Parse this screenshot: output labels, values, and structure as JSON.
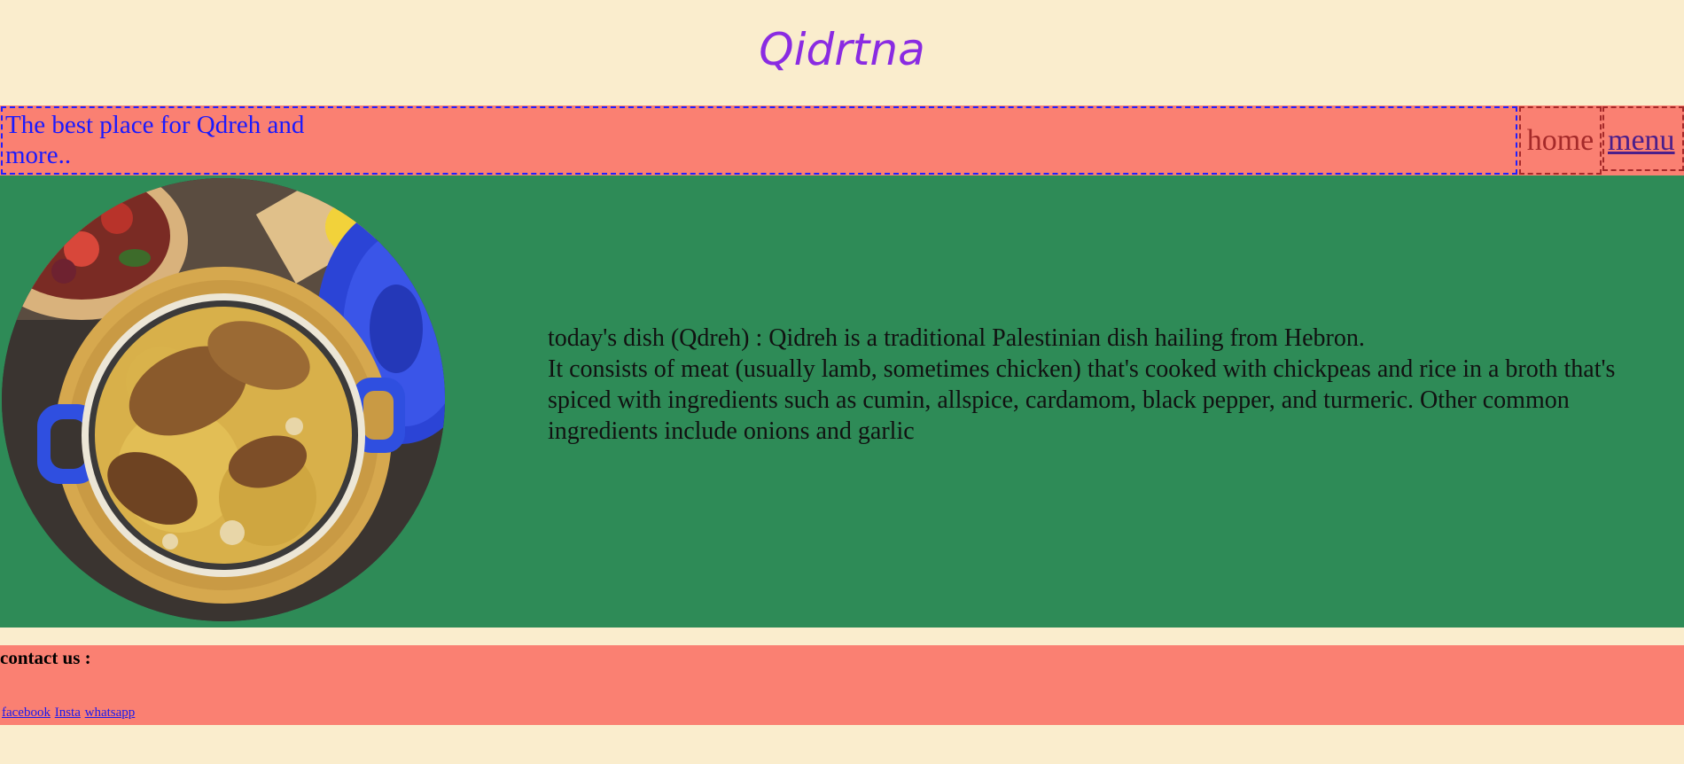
{
  "site": {
    "title": "Qidrtna",
    "tagline": "The best place for Qdreh and more.."
  },
  "nav": {
    "home_label": "home",
    "menu_label": "menu"
  },
  "hero": {
    "image_icon": "qidreh-dish-photo",
    "description_lines": [
      "today's dish (Qdreh) : Qidreh is a traditional Palestinian dish hailing from Hebron.",
      "It consists of meat (usually lamb, sometimes chicken) that's cooked with chickpeas and rice in a broth that's spiced with ingredients such as cumin, allspice, cardamom, black pepper, and turmeric. Other common",
      "ingredients include onions and garlic"
    ]
  },
  "footer": {
    "contact_heading": "contact us :",
    "links": {
      "facebook": "facebook",
      "insta": "Insta",
      "whatsapp": "whatsapp"
    }
  },
  "colors": {
    "background": "#faedcd",
    "title": "#8a2be2",
    "bar": "#fa8072",
    "hero": "#2e8b57",
    "tagline_text": "#1a1aff",
    "home_text": "#a52a2a",
    "menu_link": "#4b1e8a"
  }
}
